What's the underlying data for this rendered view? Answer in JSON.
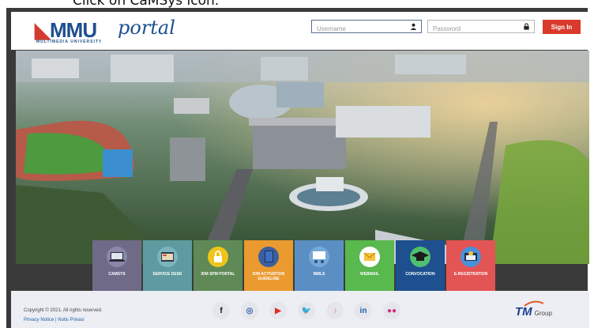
{
  "instruction": {
    "text": "Click on CaMSys icon."
  },
  "header": {
    "logo_mmu": "MMU",
    "logo_portal": "portal",
    "logo_sub": "MULTIMEDIA UNIVERSITY",
    "username_placeholder": "Username",
    "password_placeholder": "Password",
    "signin_label": "Sign In",
    "accent_color": "#d93a2b",
    "brand_color": "#1d4f8f"
  },
  "tiles": [
    {
      "label": "CAMSYS",
      "color": "#6f6a88",
      "icon": "laptop-icon"
    },
    {
      "label": "SERVICE DESK",
      "color": "#5f9aa0",
      "icon": "service-desk-icon"
    },
    {
      "label": "IDM SPM PORTAL",
      "color": "#5f8a57",
      "icon": "lock-icon"
    },
    {
      "label": "IDM ACTIVATION GUIDELINE",
      "color": "#ea9a2f",
      "icon": "book-icon"
    },
    {
      "label": "MMLS",
      "color": "#5b8fc4",
      "icon": "classroom-icon"
    },
    {
      "label": "WEBMAIL",
      "color": "#59b84e",
      "icon": "mail-icon"
    },
    {
      "label": "CONVOCATION",
      "color": "#1e4f8f",
      "icon": "graduation-cap-icon"
    },
    {
      "label": "E-REGISTRATION",
      "color": "#e35454",
      "icon": "registration-icon"
    }
  ],
  "footer": {
    "copyright": "Copyright © 2021. All rights reserved.",
    "links": "Privacy Notice | Notis Privasi",
    "tm_label": "TM",
    "tm_group": "Group",
    "social": [
      {
        "glyph": "f",
        "icon": "facebook-icon",
        "color": "#111111",
        "bg": "#e4e6ec"
      },
      {
        "glyph": "◎",
        "icon": "instagram-icon",
        "color": "#3b62b0",
        "bg": "#e4e6ec"
      },
      {
        "glyph": "▶",
        "icon": "youtube-icon",
        "color": "#e02a2a",
        "bg": "#e4e6ec"
      },
      {
        "glyph": "🐦",
        "icon": "twitter-icon",
        "color": "#1d5fa8",
        "bg": "#e4e6ec"
      },
      {
        "glyph": "♪",
        "icon": "tiktok-icon",
        "color": "#e07aa0",
        "bg": "#e4e6ec"
      },
      {
        "glyph": "in",
        "icon": "linkedin-icon",
        "color": "#1d5fa8",
        "bg": "#e4e6ec"
      },
      {
        "glyph": "●●",
        "icon": "flickr-icon",
        "color": "#d0317b",
        "bg": "#e4e6ec"
      }
    ]
  }
}
